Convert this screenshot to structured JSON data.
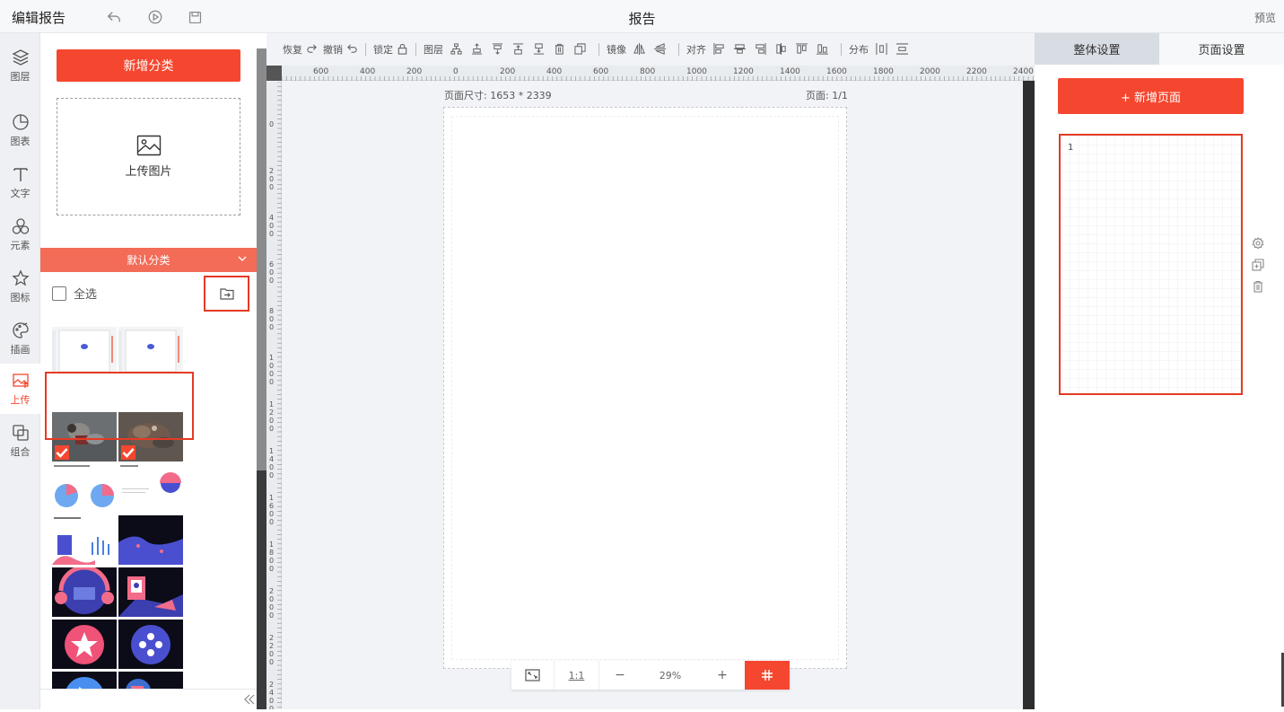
{
  "header": {
    "title": "编辑报告",
    "center_title": "报告",
    "preview_label": "预览",
    "icons": [
      "undo-icon",
      "play-icon",
      "save-icon"
    ]
  },
  "leftnav": {
    "items": [
      {
        "label": "图层",
        "icon": "layers-icon"
      },
      {
        "label": "图表",
        "icon": "pie-chart-icon"
      },
      {
        "label": "文字",
        "icon": "text-icon"
      },
      {
        "label": "元素",
        "icon": "shapes-icon"
      },
      {
        "label": "图标",
        "icon": "star-icon"
      },
      {
        "label": "插画",
        "icon": "palette-icon"
      },
      {
        "label": "上传",
        "icon": "upload-image-icon"
      },
      {
        "label": "组合",
        "icon": "group-icon"
      }
    ],
    "active": "上传",
    "active_color": "#f5472f"
  },
  "panel": {
    "add_category_label": "新增分类",
    "upload_label": "上传图片",
    "category_label": "默认分类",
    "select_all_label": "全选"
  },
  "toolbar": {
    "redo_label": "恢复",
    "undo_label": "撤销",
    "lock_label": "锁定",
    "layer_label": "图层",
    "mirror_label": "镜像",
    "align_label": "对齐",
    "distribute_label": "分布"
  },
  "ruler": {
    "top_labels": [
      "600",
      "400",
      "200",
      "0",
      "200",
      "400",
      "600",
      "800",
      "1000",
      "1200",
      "1400",
      "1600",
      "1800",
      "2000",
      "2200",
      "2400"
    ],
    "left_labels": [
      "0",
      "200",
      "400",
      "600",
      "800",
      "1000",
      "1200",
      "1400",
      "1600",
      "1800",
      "2000",
      "2200",
      "2400"
    ]
  },
  "canvas": {
    "page_size_label": "页面尺寸: 1653 * 2339",
    "page_count_label": "页面: 1/1"
  },
  "zoom": {
    "ratio_label": "1:1",
    "minus_label": "−",
    "value": "29%",
    "plus_label": "+"
  },
  "rightpanel": {
    "tab_global": "整体设置",
    "tab_page": "页面设置",
    "add_page_label": "+ 新增页面",
    "page_number": "1"
  },
  "colors": {
    "accent": "#f5472f",
    "selection_border": "#e53a24"
  }
}
